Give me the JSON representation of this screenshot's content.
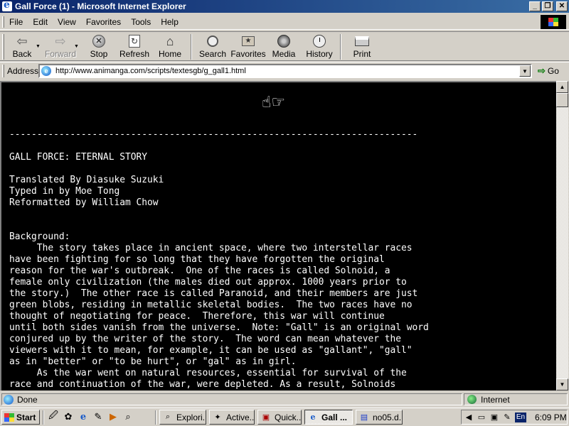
{
  "window": {
    "title": "Gall Force (1) - Microsoft Internet Explorer",
    "minimize": "_",
    "maximize": "❐",
    "close": "✕"
  },
  "menu": {
    "items": [
      "File",
      "Edit",
      "View",
      "Favorites",
      "Tools",
      "Help"
    ]
  },
  "toolbar": {
    "back": "Back",
    "forward": "Forward",
    "stop": "Stop",
    "refresh": "Refresh",
    "home": "Home",
    "search": "Search",
    "favorites": "Favorites",
    "media": "Media",
    "history": "History",
    "print": "Print"
  },
  "address": {
    "label": "Address",
    "url": "http://www.animanga.com/scripts/textesgb/g_gall1.html",
    "go": "Go"
  },
  "page": {
    "text": "--------------------------------------------------------------------------\n\nGALL FORCE: ETERNAL STORY\n\nTranslated By Diasuke Suzuki\nTyped in by Moe Tong\nReformatted by William Chow\n\n\nBackground:\n     The story takes place in ancient space, where two interstellar races\nhave been fighting for so long that they have forgotten the original\nreason for the war's outbreak.  One of the races is called Solnoid, a\nfemale only civilization (the males died out approx. 1000 years prior to\nthe story.)  The other race is called Paranoid, and their members are just\ngreen blobs, residing in metallic skeletal bodies.  The two races have no\nthought of negotiating for peace.  Therefore, this war will continue\nuntil both sides vanish from the universe.  Note: \"Gall\" is an original word\nconjured up by the writer of the story.  The word can mean whatever the\nviewers with it to mean, for example, it can be used as \"gallant\", \"gall\"\nas in \"better\" or \"to be hurt\", or \"gal\" as in girl.\n     As the war went on natural resources, essential for survival of the\nrace and continuation of the war, were depleted. As a result, Solnoids"
  },
  "status": {
    "text": "Done",
    "zone": "Internet"
  },
  "taskbar": {
    "start": "Start",
    "tasks": [
      "Explori...",
      "Active...",
      "Quick...",
      "Gall ...",
      "no05.d..."
    ],
    "lang": "En",
    "time": "6:09 PM"
  }
}
